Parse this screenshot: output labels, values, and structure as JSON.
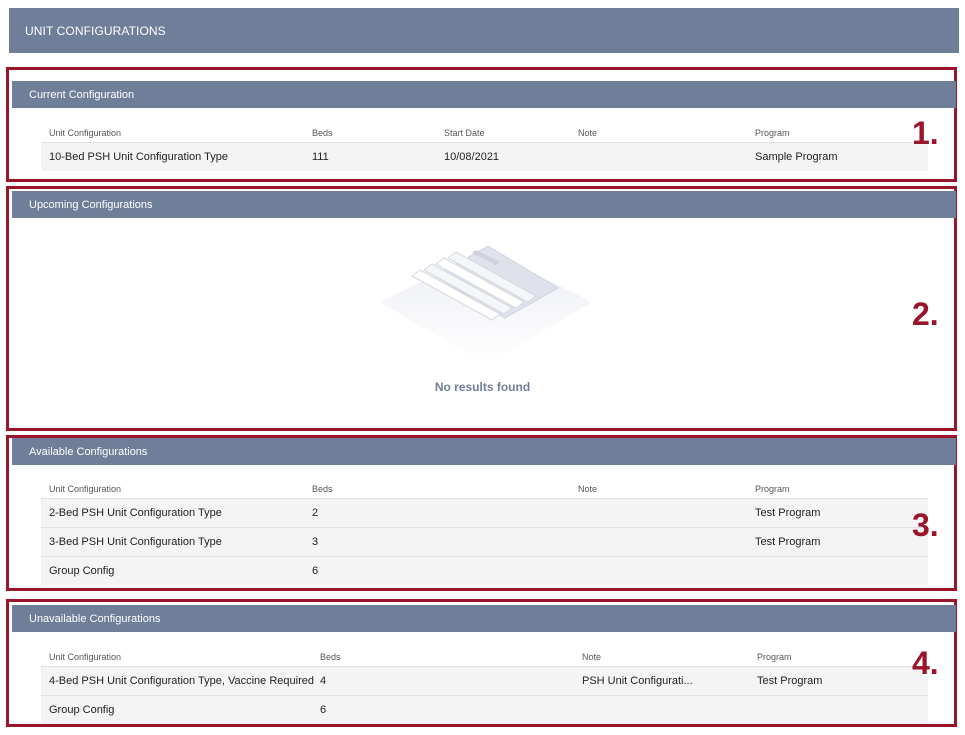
{
  "page_title": "UNIT CONFIGURATIONS",
  "markers": [
    "1.",
    "2.",
    "3.",
    "4."
  ],
  "current": {
    "title": "Current Configuration",
    "columns": [
      "Unit Configuration",
      "Beds",
      "Start Date",
      "Note",
      "Program"
    ],
    "rows": [
      {
        "unit": "10-Bed PSH Unit Configuration Type",
        "beds": "111",
        "start": "10/08/2021",
        "note": "",
        "program": "Sample Program"
      }
    ]
  },
  "upcoming": {
    "title": "Upcoming Configurations",
    "empty_text": "No results found"
  },
  "available": {
    "title": "Available Configurations",
    "columns": [
      "Unit Configuration",
      "Beds",
      "Note",
      "Program"
    ],
    "rows": [
      {
        "unit": "2-Bed PSH Unit Configuration Type",
        "beds": "2",
        "note": "",
        "program": "Test Program"
      },
      {
        "unit": "3-Bed PSH Unit Configuration Type",
        "beds": "3",
        "note": "",
        "program": "Test Program"
      },
      {
        "unit": "Group Config",
        "beds": "6",
        "note": "",
        "program": ""
      }
    ]
  },
  "unavailable": {
    "title": "Unavailable Configurations",
    "columns": [
      "Unit Configuration",
      "Beds",
      "Note",
      "Program"
    ],
    "rows": [
      {
        "unit": "4-Bed PSH Unit Configuration Type, Vaccine Required",
        "beds": "4",
        "note": "PSH Unit Configurati...",
        "program": "Test Program"
      },
      {
        "unit": "Group Config",
        "beds": "6",
        "note": "",
        "program": ""
      }
    ]
  },
  "colors": {
    "header_bg": "#6f7f99",
    "outline": "#9a1529",
    "row_bg": "#f4f4f5"
  }
}
